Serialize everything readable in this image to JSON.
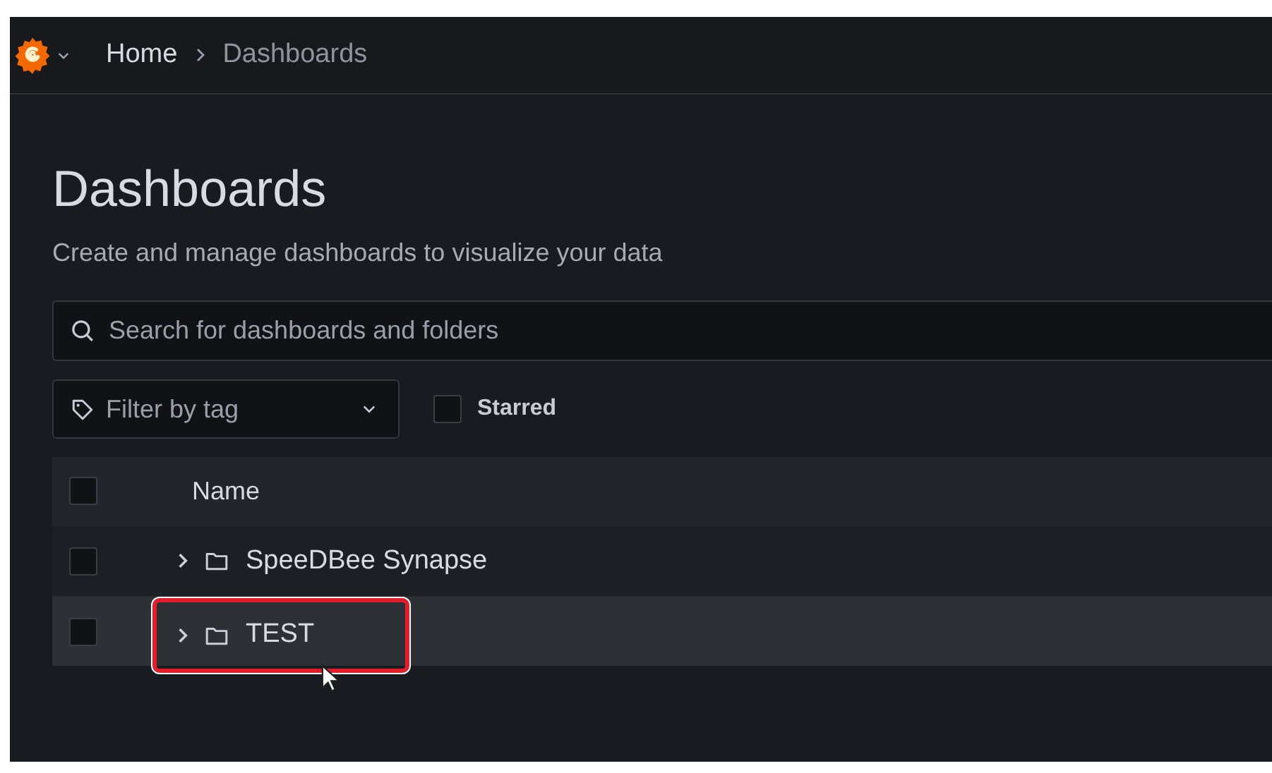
{
  "breadcrumbs": [
    {
      "label": "Home",
      "current": false
    },
    {
      "label": "Dashboards",
      "current": true
    }
  ],
  "page": {
    "title": "Dashboards",
    "subtitle": "Create and manage dashboards to visualize your data"
  },
  "search": {
    "placeholder": "Search for dashboards and folders"
  },
  "tag_filter": {
    "placeholder": "Filter by tag"
  },
  "starred": {
    "label": "Starred",
    "checked": false
  },
  "table": {
    "header_checked": false,
    "columns": [
      "Name"
    ],
    "rows": [
      {
        "name": "SpeeDBee Synapse",
        "kind": "folder",
        "checked": false,
        "hovered": false,
        "outlined": false
      },
      {
        "name": "TEST",
        "kind": "folder",
        "checked": false,
        "hovered": true,
        "outlined": true
      }
    ]
  }
}
